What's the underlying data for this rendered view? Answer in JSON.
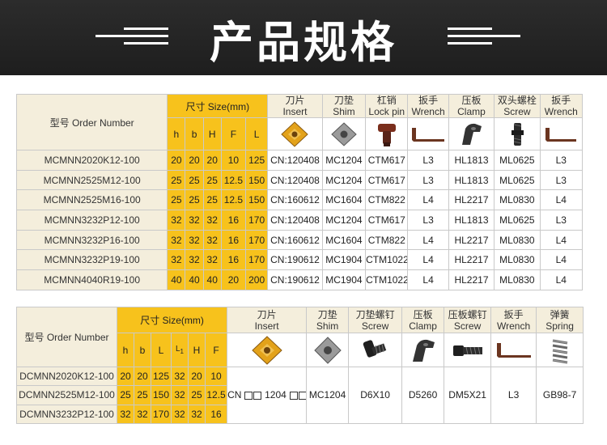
{
  "header": {
    "title": "产品规格"
  },
  "table1": {
    "model_header": "型号 Order Number",
    "size_header": "尺寸 Size(mm)",
    "dims": [
      "h",
      "b",
      "H",
      "F",
      "L"
    ],
    "parts": [
      {
        "cn": "刀片",
        "en": "Insert",
        "icon": "insert-icon"
      },
      {
        "cn": "刀垫",
        "en": "Shim",
        "icon": "shim-icon"
      },
      {
        "cn": "杠销",
        "en": "Lock pin",
        "icon": "lock-pin-icon"
      },
      {
        "cn": "扳手",
        "en": "Wrench",
        "icon": "wrench-icon"
      },
      {
        "cn": "压板",
        "en": "Clamp",
        "icon": "clamp-icon"
      },
      {
        "cn": "双头螺栓",
        "en": "Screw",
        "icon": "double-screw-icon"
      },
      {
        "cn": "扳手",
        "en": "Wrench",
        "icon": "wrench-icon"
      }
    ],
    "rows": [
      {
        "model": "MCMNN2020K12-100",
        "dims": [
          "20",
          "20",
          "20",
          "10",
          "125"
        ],
        "insert": "CN:120408",
        "shim": "MC1204",
        "pin": "CTM617",
        "wrench": "L3",
        "clamp": "HL1813",
        "screw": "ML0625",
        "wrench2": "L3"
      },
      {
        "model": "MCMNN2525M12-100",
        "dims": [
          "25",
          "25",
          "25",
          "12.5",
          "150"
        ],
        "insert": "CN:120408",
        "shim": "MC1204",
        "pin": "CTM617",
        "wrench": "L3",
        "clamp": "HL1813",
        "screw": "ML0625",
        "wrench2": "L3"
      },
      {
        "model": "MCMNN2525M16-100",
        "dims": [
          "25",
          "25",
          "25",
          "12.5",
          "150"
        ],
        "insert": "CN:160612",
        "shim": "MC1604",
        "pin": "CTM822",
        "wrench": "L4",
        "clamp": "HL2217",
        "screw": "ML0830",
        "wrench2": "L4"
      },
      {
        "model": "MCMNN3232P12-100",
        "dims": [
          "32",
          "32",
          "32",
          "16",
          "170"
        ],
        "insert": "CN:120408",
        "shim": "MC1204",
        "pin": "CTM617",
        "wrench": "L3",
        "clamp": "HL1813",
        "screw": "ML0625",
        "wrench2": "L3"
      },
      {
        "model": "MCMNN3232P16-100",
        "dims": [
          "32",
          "32",
          "32",
          "16",
          "170"
        ],
        "insert": "CN:160612",
        "shim": "MC1604",
        "pin": "CTM822",
        "wrench": "L4",
        "clamp": "HL2217",
        "screw": "ML0830",
        "wrench2": "L4"
      },
      {
        "model": "MCMNN3232P19-100",
        "dims": [
          "32",
          "32",
          "32",
          "16",
          "170"
        ],
        "insert": "CN:190612",
        "shim": "MC1904",
        "pin": "CTM1022",
        "wrench": "L4",
        "clamp": "HL2217",
        "screw": "ML0830",
        "wrench2": "L4"
      },
      {
        "model": "MCMNN4040R19-100",
        "dims": [
          "40",
          "40",
          "40",
          "20",
          "200"
        ],
        "insert": "CN:190612",
        "shim": "MC1904",
        "pin": "CTM1022",
        "wrench": "L4",
        "clamp": "HL2217",
        "screw": "ML0830",
        "wrench2": "L4"
      }
    ]
  },
  "table2": {
    "model_header": "型号 Order Number",
    "size_header": "尺寸 Size(mm)",
    "dims": [
      "h",
      "b",
      "L",
      "L1",
      "H",
      "F"
    ],
    "parts": [
      {
        "cn": "刀片",
        "en": "Insert",
        "icon": "insert-icon"
      },
      {
        "cn": "刀垫",
        "en": "Shim",
        "icon": "shim-icon"
      },
      {
        "cn": "刀垫螺钉",
        "en": "Screw",
        "icon": "shim-screw-icon"
      },
      {
        "cn": "压板",
        "en": "Clamp",
        "icon": "clamp-icon"
      },
      {
        "cn": "压板螺钉",
        "en": "Screw",
        "icon": "clamp-screw-icon"
      },
      {
        "cn": "扳手",
        "en": "Wrench",
        "icon": "wrench-icon"
      },
      {
        "cn": "弹簧",
        "en": "Spring",
        "icon": "spring-icon"
      }
    ],
    "rows": [
      {
        "model": "DCMNN2020K12-100",
        "dims": [
          "20",
          "20",
          "125",
          "32",
          "20",
          "10"
        ]
      },
      {
        "model": "DCMNN2525M12-100",
        "dims": [
          "25",
          "25",
          "150",
          "32",
          "25",
          "12.5"
        ]
      },
      {
        "model": "DCMNN3232P12-100",
        "dims": [
          "32",
          "32",
          "170",
          "32",
          "32",
          "16"
        ]
      }
    ],
    "shared": {
      "insert_prefix": "CN",
      "insert_mid": "1204",
      "shim": "MC1204",
      "shim_screw": "D6X10",
      "clamp": "D5260",
      "clamp_screw": "DM5X21",
      "wrench": "L3",
      "spring": "GB98-7"
    }
  },
  "colors": {
    "yellow": "#f7c21c",
    "cream": "#f4eedc",
    "banner": "#262626"
  }
}
